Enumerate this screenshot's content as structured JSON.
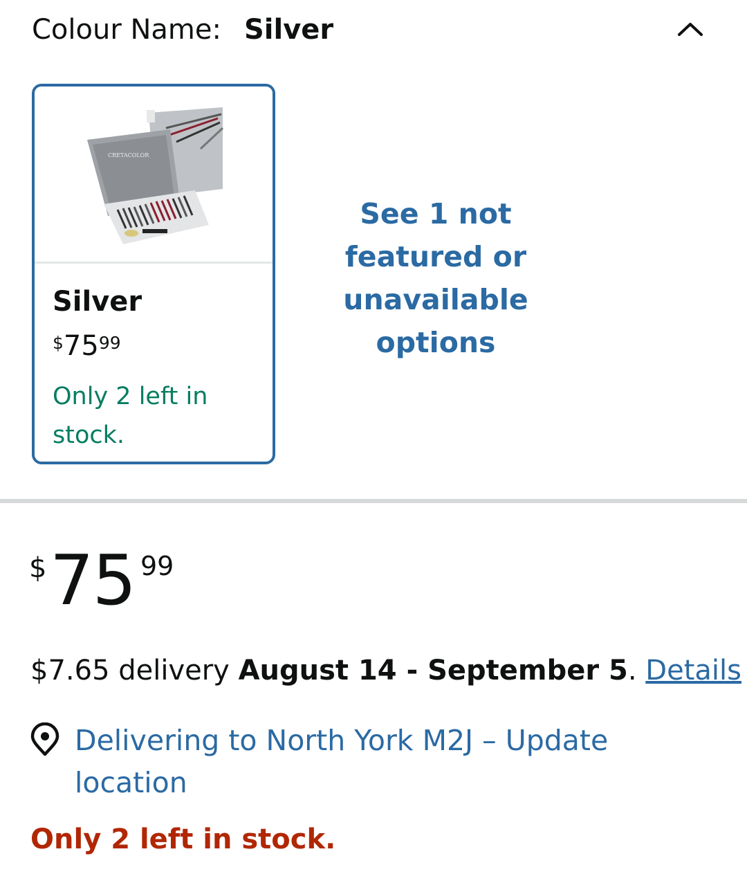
{
  "header": {
    "label": "Colour Name:",
    "value": "Silver",
    "collapse_icon": "chevron-up-icon"
  },
  "swatch": {
    "image_alt": "Cretacolor Silver drawing set",
    "image_text": "CRETACOLOR",
    "name": "Silver",
    "price_currency": "$",
    "price_whole": "75",
    "price_fraction": "99",
    "stock": "Only 2 left in stock."
  },
  "more_options": "See 1 not featured or unavailable options",
  "price": {
    "currency": "$",
    "whole": "75",
    "fraction": "99"
  },
  "delivery": {
    "cost": "$7.65 delivery ",
    "dates": "August 14 - September 5",
    "period": ". ",
    "details_link": "Details"
  },
  "location": {
    "icon": "location-pin-icon",
    "text": "Delivering to North York M2J – Update location"
  },
  "stock_warning": "Only 2 left in stock.",
  "colors": {
    "link": "#2b6aa3",
    "in_stock": "#067d62",
    "warning": "#b12704",
    "selected_border": "#2b6aa3"
  }
}
